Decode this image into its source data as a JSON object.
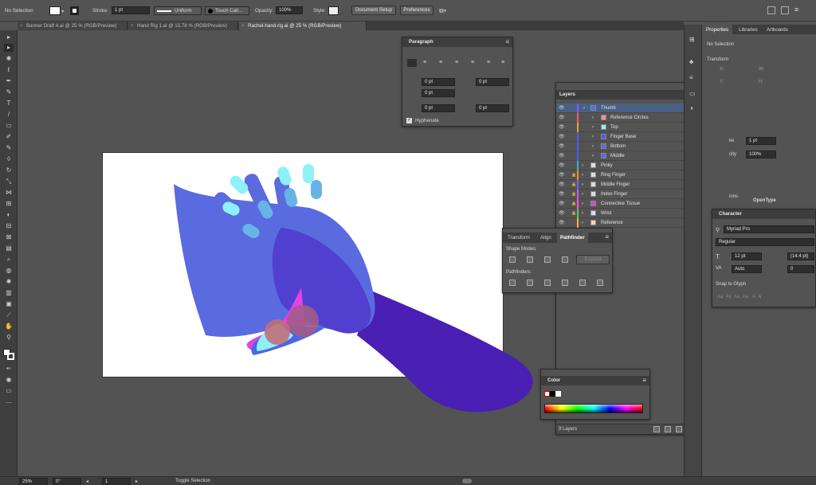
{
  "control_bar": {
    "selection": "No Selection",
    "stroke_label": "Stroke:",
    "stroke_weight": "1 pt",
    "stroke_profile": "Uniform",
    "brush": "Touch Call...",
    "opacity_label": "Opacity:",
    "opacity": "100%",
    "style_label": "Style:",
    "document_setup": "Document Setup",
    "preferences": "Preferences"
  },
  "tabs": [
    "Banner Draft 4.ai @ 25 % (RGB/Preview)",
    "Hand Rig 1.ai @ 15.78 % (RGB/Preview)",
    "Rachel-hand-rig.ai @ 25 % (RGB/Preview)"
  ],
  "paragraph": {
    "title": "Paragraph",
    "left_indent": "0 pt",
    "right_indent": "0 pt",
    "first_indent": "0 pt",
    "space_before": "0 pt",
    "space_after": "0 pt",
    "hyphenate": "Hyphenate"
  },
  "layers": {
    "title": "Layers",
    "rows": [
      "Thumb",
      "Reference Circles",
      "Top",
      "Finger Base",
      "Bottom",
      "Middle",
      "Pinky",
      "Ring Finger",
      "Middle Finger",
      "Index Finger",
      "Connective Tissue",
      "Wrist",
      "Reference"
    ],
    "footer": "9 Layers",
    "colors": [
      "#7b5cff",
      "#ff5c5c",
      "#e9a23b",
      "#4a5cff",
      "#4a5cff",
      "#4a5cff",
      "#35b6c4",
      "#ff8a3d",
      "#6a6aff",
      "#c85cff",
      "#ff4ff0",
      "#47d16a",
      "#ffb13b"
    ]
  },
  "pathfinder": {
    "tabs": [
      "Transform",
      "Align",
      "Pathfinder"
    ],
    "shape_modes": "Shape Modes:",
    "pathfinders": "Pathfinders:",
    "expand": "Expand"
  },
  "color": {
    "title": "Color"
  },
  "character": {
    "title": "Character",
    "font": "Myriad Pro",
    "style": "Regular",
    "size": "12 pt",
    "leading": "(14.4 pt)",
    "kerning": "Auto",
    "tracking": "0",
    "snap": "Snap to Glyph"
  },
  "properties": {
    "tabs": [
      "Properties",
      "Libraries",
      "Artboards"
    ],
    "selection": "No Selection",
    "transform": "Transform",
    "x_label": "X:",
    "y_label": "Y:",
    "w_label": "W:",
    "h_label": "H:",
    "stroke_frag": "ke",
    "stroke_val": "1 pt",
    "opacity_frag": "city",
    "opacity_val": "100%",
    "ions": "ions",
    "opentype": "OpenType"
  },
  "status": {
    "zoom": "25%",
    "rotate": "0°",
    "artboard": "1",
    "mode": "Toggle Selection"
  }
}
